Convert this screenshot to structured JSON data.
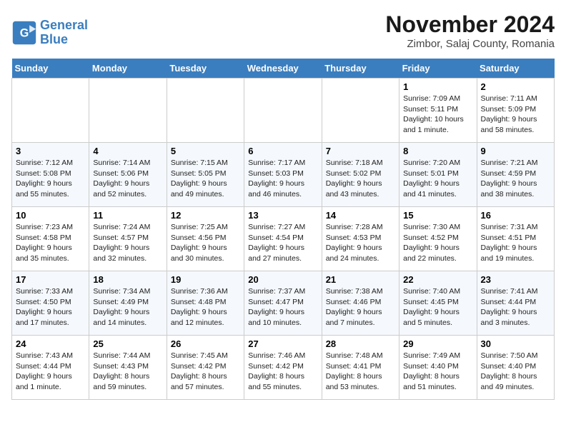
{
  "header": {
    "logo_line1": "General",
    "logo_line2": "Blue",
    "month_title": "November 2024",
    "subtitle": "Zimbor, Salaj County, Romania"
  },
  "weekdays": [
    "Sunday",
    "Monday",
    "Tuesday",
    "Wednesday",
    "Thursday",
    "Friday",
    "Saturday"
  ],
  "weeks": [
    [
      {
        "day": "",
        "info": ""
      },
      {
        "day": "",
        "info": ""
      },
      {
        "day": "",
        "info": ""
      },
      {
        "day": "",
        "info": ""
      },
      {
        "day": "",
        "info": ""
      },
      {
        "day": "1",
        "info": "Sunrise: 7:09 AM\nSunset: 5:11 PM\nDaylight: 10 hours and 1 minute."
      },
      {
        "day": "2",
        "info": "Sunrise: 7:11 AM\nSunset: 5:09 PM\nDaylight: 9 hours and 58 minutes."
      }
    ],
    [
      {
        "day": "3",
        "info": "Sunrise: 7:12 AM\nSunset: 5:08 PM\nDaylight: 9 hours and 55 minutes."
      },
      {
        "day": "4",
        "info": "Sunrise: 7:14 AM\nSunset: 5:06 PM\nDaylight: 9 hours and 52 minutes."
      },
      {
        "day": "5",
        "info": "Sunrise: 7:15 AM\nSunset: 5:05 PM\nDaylight: 9 hours and 49 minutes."
      },
      {
        "day": "6",
        "info": "Sunrise: 7:17 AM\nSunset: 5:03 PM\nDaylight: 9 hours and 46 minutes."
      },
      {
        "day": "7",
        "info": "Sunrise: 7:18 AM\nSunset: 5:02 PM\nDaylight: 9 hours and 43 minutes."
      },
      {
        "day": "8",
        "info": "Sunrise: 7:20 AM\nSunset: 5:01 PM\nDaylight: 9 hours and 41 minutes."
      },
      {
        "day": "9",
        "info": "Sunrise: 7:21 AM\nSunset: 4:59 PM\nDaylight: 9 hours and 38 minutes."
      }
    ],
    [
      {
        "day": "10",
        "info": "Sunrise: 7:23 AM\nSunset: 4:58 PM\nDaylight: 9 hours and 35 minutes."
      },
      {
        "day": "11",
        "info": "Sunrise: 7:24 AM\nSunset: 4:57 PM\nDaylight: 9 hours and 32 minutes."
      },
      {
        "day": "12",
        "info": "Sunrise: 7:25 AM\nSunset: 4:56 PM\nDaylight: 9 hours and 30 minutes."
      },
      {
        "day": "13",
        "info": "Sunrise: 7:27 AM\nSunset: 4:54 PM\nDaylight: 9 hours and 27 minutes."
      },
      {
        "day": "14",
        "info": "Sunrise: 7:28 AM\nSunset: 4:53 PM\nDaylight: 9 hours and 24 minutes."
      },
      {
        "day": "15",
        "info": "Sunrise: 7:30 AM\nSunset: 4:52 PM\nDaylight: 9 hours and 22 minutes."
      },
      {
        "day": "16",
        "info": "Sunrise: 7:31 AM\nSunset: 4:51 PM\nDaylight: 9 hours and 19 minutes."
      }
    ],
    [
      {
        "day": "17",
        "info": "Sunrise: 7:33 AM\nSunset: 4:50 PM\nDaylight: 9 hours and 17 minutes."
      },
      {
        "day": "18",
        "info": "Sunrise: 7:34 AM\nSunset: 4:49 PM\nDaylight: 9 hours and 14 minutes."
      },
      {
        "day": "19",
        "info": "Sunrise: 7:36 AM\nSunset: 4:48 PM\nDaylight: 9 hours and 12 minutes."
      },
      {
        "day": "20",
        "info": "Sunrise: 7:37 AM\nSunset: 4:47 PM\nDaylight: 9 hours and 10 minutes."
      },
      {
        "day": "21",
        "info": "Sunrise: 7:38 AM\nSunset: 4:46 PM\nDaylight: 9 hours and 7 minutes."
      },
      {
        "day": "22",
        "info": "Sunrise: 7:40 AM\nSunset: 4:45 PM\nDaylight: 9 hours and 5 minutes."
      },
      {
        "day": "23",
        "info": "Sunrise: 7:41 AM\nSunset: 4:44 PM\nDaylight: 9 hours and 3 minutes."
      }
    ],
    [
      {
        "day": "24",
        "info": "Sunrise: 7:43 AM\nSunset: 4:44 PM\nDaylight: 9 hours and 1 minute."
      },
      {
        "day": "25",
        "info": "Sunrise: 7:44 AM\nSunset: 4:43 PM\nDaylight: 8 hours and 59 minutes."
      },
      {
        "day": "26",
        "info": "Sunrise: 7:45 AM\nSunset: 4:42 PM\nDaylight: 8 hours and 57 minutes."
      },
      {
        "day": "27",
        "info": "Sunrise: 7:46 AM\nSunset: 4:42 PM\nDaylight: 8 hours and 55 minutes."
      },
      {
        "day": "28",
        "info": "Sunrise: 7:48 AM\nSunset: 4:41 PM\nDaylight: 8 hours and 53 minutes."
      },
      {
        "day": "29",
        "info": "Sunrise: 7:49 AM\nSunset: 4:40 PM\nDaylight: 8 hours and 51 minutes."
      },
      {
        "day": "30",
        "info": "Sunrise: 7:50 AM\nSunset: 4:40 PM\nDaylight: 8 hours and 49 minutes."
      }
    ]
  ]
}
